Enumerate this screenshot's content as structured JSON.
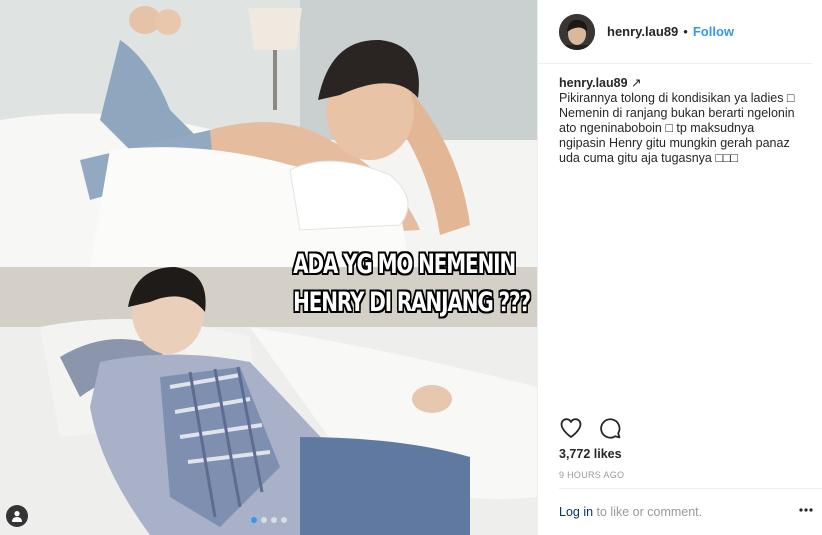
{
  "colors": {
    "accent_blue": "#3897f0",
    "link_dark_blue": "#003569",
    "text": "#262626",
    "muted": "#999999",
    "border": "#efefef"
  },
  "media": {
    "overlay_lines": [
      "ADA YG MO NEMENIN",
      "HENRY DI RANJANG ???"
    ],
    "carousel": {
      "total": 4,
      "active_index": 0
    },
    "tag_icon": "user-tag-icon"
  },
  "header": {
    "username": "henry.lau89",
    "separator": "•",
    "follow_label": "Follow"
  },
  "caption": {
    "username": "henry.lau89",
    "badge": "↗",
    "text": "Pikirannya tolong di kondisikan ya ladies □ Nemenin di ranjang bukan berarti ngelonin ato ngeninaboboin □ tp maksudnya ngipasin Henry gitu mungkin gerah panaz uda cuma gitu aja tugasnya □□□"
  },
  "actions": {
    "like_icon": "heart-icon",
    "comment_icon": "comment-icon"
  },
  "likes": "3,772 likes",
  "timestamp": "9 HOURS AGO",
  "footer": {
    "login_label": "Log in",
    "rest_text": " to like or comment.",
    "more_icon": "more-options-icon"
  }
}
